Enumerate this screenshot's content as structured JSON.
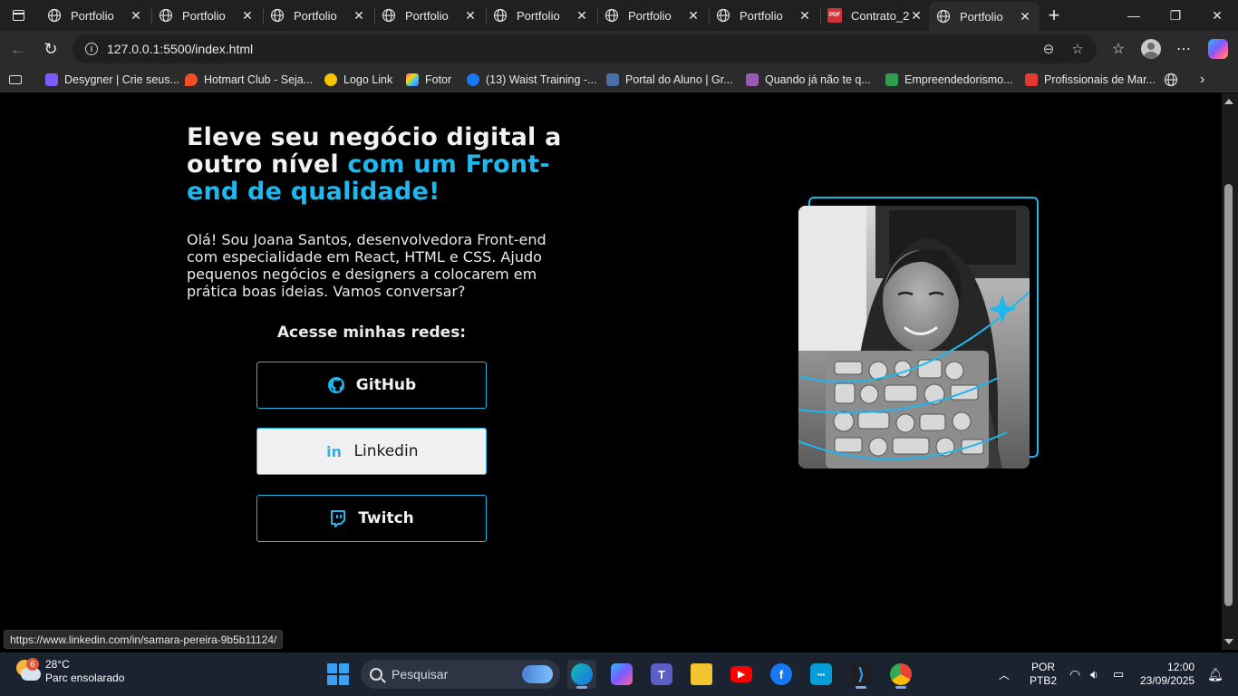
{
  "browser": {
    "tabs": [
      {
        "title": "Portfolio",
        "favicon": "globe-icon"
      },
      {
        "title": "Portfolio",
        "favicon": "globe-icon"
      },
      {
        "title": "Portfolio",
        "favicon": "globe-icon"
      },
      {
        "title": "Portfolio",
        "favicon": "globe-icon"
      },
      {
        "title": "Portfolio",
        "favicon": "globe-icon"
      },
      {
        "title": "Portfolio",
        "favicon": "globe-icon"
      },
      {
        "title": "Portfolio",
        "favicon": "globe-icon"
      },
      {
        "title": "Contrato_2",
        "favicon": "pdf-icon",
        "pdf_label": "PDF"
      },
      {
        "title": "Portfolio",
        "favicon": "globe-icon",
        "active": true
      }
    ],
    "url": "127.0.0.1:5500/index.html",
    "bookmarks": [
      {
        "label": "Desygner | Crie seus...",
        "color": "#7b5cff"
      },
      {
        "label": "Hotmart Club - Seja...",
        "color": "#f04e23"
      },
      {
        "label": "Logo Link",
        "color": "#f5c400"
      },
      {
        "label": "Fotor",
        "color": "#ff4d8d"
      },
      {
        "label": "(13) Waist Training -...",
        "color": "#1877f2"
      },
      {
        "label": "Portal do Aluno | Gr...",
        "color": "#4a6fa5"
      },
      {
        "label": "Quando já não te q...",
        "color": "#9b59b6"
      },
      {
        "label": "Empreendedorismo...",
        "color": "#2e9e4f"
      },
      {
        "label": "Profissionais de Mar...",
        "color": "#e53935"
      }
    ],
    "status_url": "https://www.linkedin.com/in/samara-pereira-9b5b11124/"
  },
  "page": {
    "headline_white": "Eleve seu negócio digital a outro nível ",
    "headline_accent": "com um Front-end de qualidade!",
    "intro": "Olá! Sou Joana Santos, desenvolvedora Front-end com especialidade em React, HTML e CSS. Ajudo pequenos negócios e designers a colocarem em prática boas ideias. Vamos conversar?",
    "social_title": "Acesse minhas redes:",
    "social_buttons": [
      {
        "label": "GitHub",
        "icon": "github-icon"
      },
      {
        "label": "Linkedin",
        "icon": "linkedin-icon",
        "icon_text": "in",
        "hovered": true
      },
      {
        "label": "Twitch",
        "icon": "twitch-icon"
      }
    ],
    "accent_color": "#1fb8ee"
  },
  "taskbar": {
    "weather_temp": "28°C",
    "weather_desc": "Parc ensolarado",
    "weather_badge": "6",
    "search_placeholder": "Pesquisar",
    "apps": [
      "edge-icon",
      "copilot-icon",
      "teams-icon",
      "file-explorer-icon",
      "youtube-icon",
      "facebook-icon",
      "cisco-icon",
      "vscode-icon",
      "chrome-icon"
    ],
    "lang_top": "POR",
    "lang_bottom": "PTB2",
    "time": "12:00",
    "date": "23/09/2025"
  }
}
